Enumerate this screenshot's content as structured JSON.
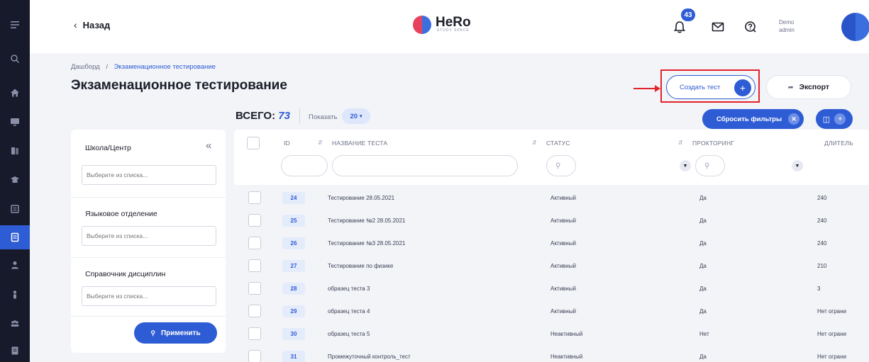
{
  "rail": {
    "items": [
      {
        "icon": "menu-icon",
        "active": false
      },
      {
        "icon": "search-icon",
        "active": false
      },
      {
        "icon": "home-icon",
        "active": false
      },
      {
        "icon": "monitor-icon",
        "active": false
      },
      {
        "icon": "book-icon",
        "active": false
      },
      {
        "icon": "graduation-cap-icon",
        "active": false
      },
      {
        "icon": "certificate-icon",
        "active": false
      },
      {
        "icon": "test-sheet-icon",
        "active": true
      },
      {
        "icon": "user-group-icon",
        "active": false
      },
      {
        "icon": "teacher-icon",
        "active": false
      },
      {
        "icon": "people-icon",
        "active": false
      },
      {
        "icon": "document-icon",
        "active": false
      }
    ]
  },
  "topbar": {
    "back_label": "Назад",
    "logo_text": "HeRo",
    "logo_sub": "STUDY SPACE",
    "notifications_count": "43",
    "user_line1": "Demo",
    "user_line2": "admin"
  },
  "breadcrumb": {
    "root": "Дашборд",
    "separator": "/",
    "current": "Экзаменационное тестирование"
  },
  "page_title": "Экзаменационное тестирование",
  "actions": {
    "create_label": "Создать тест",
    "export_label": "Экспорт",
    "highlight_color": "#e2232a"
  },
  "toolbar": {
    "total_label": "ВСЕГО:",
    "total_value": "73",
    "show_label": "Показать",
    "show_value": "20",
    "reset_label": "Сбросить фильтры"
  },
  "filters": {
    "school_label": "Школа/Центр",
    "school_placeholder": "Выберите из списка...",
    "department_label": "Языковое отделение",
    "department_placeholder": "Выберите из списка...",
    "disciplines_label": "Справочник дисциплин",
    "disciplines_placeholder": "Выберите из списка...",
    "apply_label": "Применить"
  },
  "table": {
    "columns": {
      "id": "ID",
      "name": "НАЗВАНИЕ ТЕСТА",
      "status": "СТАТУС",
      "proctoring": "ПРОКТОРИНГ",
      "duration": "ДЛИТЕЛЬ"
    },
    "rows": [
      {
        "id": "24",
        "name": "Тестирование 28.05.2021",
        "status": "Активный",
        "proctoring": "Да",
        "duration": "240"
      },
      {
        "id": "25",
        "name": "Тестирование №2 28.05.2021",
        "status": "Активный",
        "proctoring": "Да",
        "duration": "240"
      },
      {
        "id": "26",
        "name": "Тестирование №3 28.05.2021",
        "status": "Активный",
        "proctoring": "Да",
        "duration": "240"
      },
      {
        "id": "27",
        "name": "Тестирование по физике",
        "status": "Активный",
        "proctoring": "Да",
        "duration": "210"
      },
      {
        "id": "28",
        "name": "образец теста 3",
        "status": "Активный",
        "proctoring": "Да",
        "duration": "3"
      },
      {
        "id": "29",
        "name": "образец теста 4",
        "status": "Активный",
        "proctoring": "Да",
        "duration": "Нет ограни"
      },
      {
        "id": "30",
        "name": "образец теста 5",
        "status": "Неактивный",
        "proctoring": "Нет",
        "duration": "Нет ограни"
      },
      {
        "id": "31",
        "name": "Промежуточный контроль_тест",
        "status": "Неактивный",
        "proctoring": "Да",
        "duration": "Нет ограни"
      }
    ]
  },
  "colors": {
    "accent": "#2e5cd4",
    "rail_bg": "#171a2b",
    "page_bg": "#f2f4f8"
  }
}
